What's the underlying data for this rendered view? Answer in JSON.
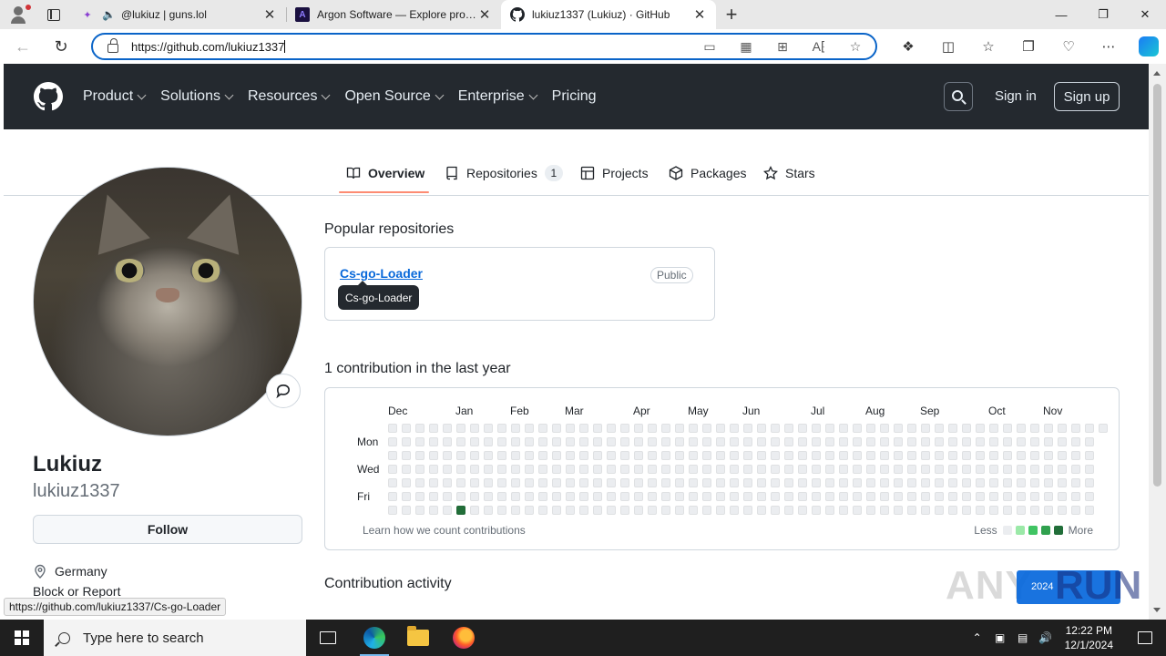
{
  "browser": {
    "tabs": [
      {
        "title": "@lukiuz | guns.lol",
        "icon": "guns-lol-icon",
        "audio": true
      },
      {
        "title": "Argon Software — Explore produ",
        "icon": "argon-icon"
      },
      {
        "title": "lukiuz1337 (Lukiuz) · GitHub",
        "icon": "github-icon",
        "active": true
      }
    ],
    "url_scheme": "https://",
    "url_host": "github.com",
    "url_path": "/lukiuz1337",
    "status_url": "https://github.com/lukiuz1337/Cs-go-Loader"
  },
  "github": {
    "nav": [
      "Product",
      "Solutions",
      "Resources",
      "Open Source",
      "Enterprise",
      "Pricing"
    ],
    "nav_has_dropdown": [
      true,
      true,
      true,
      true,
      true,
      false
    ],
    "sign_in": "Sign in",
    "sign_up": "Sign up"
  },
  "profile_tabs": {
    "overview": "Overview",
    "repositories": "Repositories",
    "repositories_count": "1",
    "projects": "Projects",
    "packages": "Packages",
    "stars": "Stars"
  },
  "profile": {
    "name": "Lukiuz",
    "login": "lukiuz1337",
    "follow": "Follow",
    "location": "Germany",
    "block_report": "Block or Report"
  },
  "popular": {
    "title": "Popular repositories",
    "repo_name": "Cs-go-Loader",
    "visibility": "Public",
    "tooltip": "Cs-go-Loader"
  },
  "contributions": {
    "title": "1 contribution in the last year",
    "months": [
      "Dec",
      "Jan",
      "Feb",
      "Mar",
      "Apr",
      "May",
      "Jun",
      "Jul",
      "Aug",
      "Sep",
      "Oct",
      "Nov"
    ],
    "days": [
      "Mon",
      "Wed",
      "Fri"
    ],
    "learn": "Learn how we count contributions",
    "less": "Less",
    "more": "More",
    "weeks": 53,
    "active_cells": [
      {
        "week": 5,
        "day": 6,
        "level": 4
      }
    ],
    "last_week_days": 1,
    "colors": [
      "#ebedf0",
      "#9be9a8",
      "#40c463",
      "#30a14e",
      "#216e39"
    ]
  },
  "activity": {
    "title": "Contribution activity"
  },
  "watermark": {
    "left": "ANY",
    "right": "RUN",
    "year": "2024"
  },
  "taskbar": {
    "search_placeholder": "Type here to search",
    "time": "12:22 PM",
    "date": "12/1/2024"
  }
}
